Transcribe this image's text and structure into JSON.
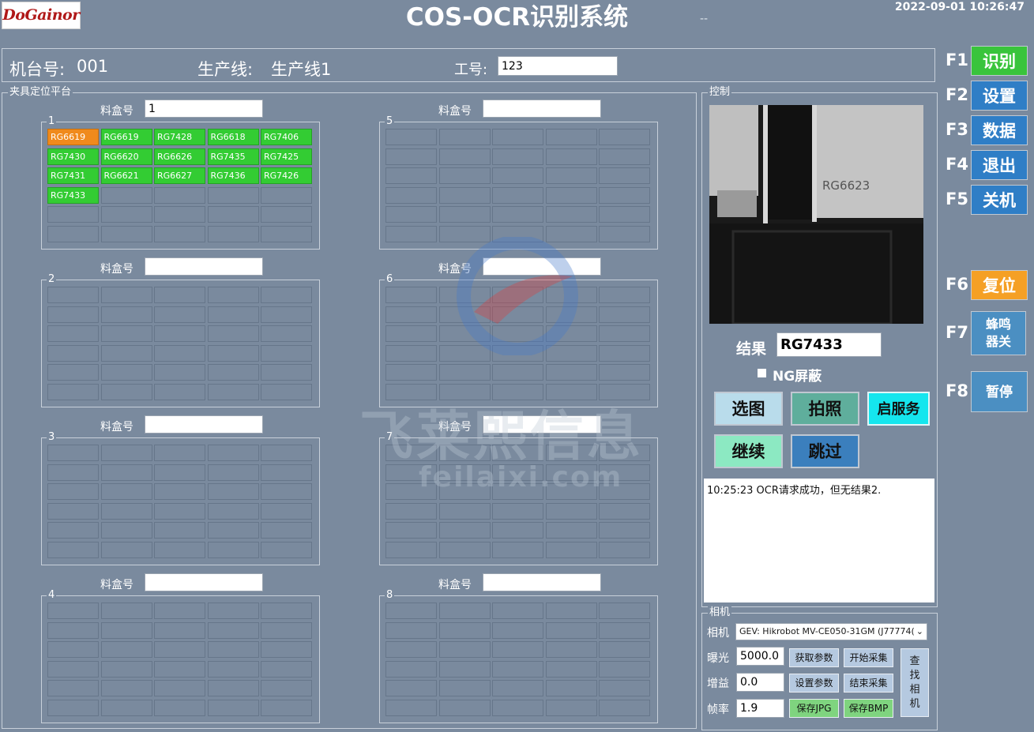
{
  "header": {
    "logo": "DoGainor",
    "title": "COS-OCR识别系统",
    "dash": "--",
    "datetime": "2022-09-01 10:26:47"
  },
  "info": {
    "machine_label": "机台号:",
    "machine_value": "001",
    "line_label": "生产线:",
    "line_value": "生产线1",
    "job_label": "工号:",
    "job_value": "123"
  },
  "fixture": {
    "title": "夹具定位平台",
    "box_label": "料盒号",
    "trays": [
      {
        "num": "1",
        "box": "1",
        "cells": [
          {
            "text": "RG6619",
            "state": "cur"
          },
          {
            "text": "RG6619",
            "state": "ok"
          },
          {
            "text": "RG7428",
            "state": "ok"
          },
          {
            "text": "RG6618",
            "state": "ok"
          },
          {
            "text": "RG7406",
            "state": "ok"
          },
          {
            "text": "RG7430",
            "state": "ok"
          },
          {
            "text": "RG6620",
            "state": "ok"
          },
          {
            "text": "RG6626",
            "state": "ok"
          },
          {
            "text": "RG7435",
            "state": "ok"
          },
          {
            "text": "RG7425",
            "state": "ok"
          },
          {
            "text": "RG7431",
            "state": "ok"
          },
          {
            "text": "RG6621",
            "state": "ok"
          },
          {
            "text": "RG6627",
            "state": "ok"
          },
          {
            "text": "RG7436",
            "state": "ok"
          },
          {
            "text": "RG7426",
            "state": "ok"
          },
          {
            "text": "RG7433",
            "state": "ok"
          }
        ]
      },
      {
        "num": "2",
        "box": "",
        "cells": []
      },
      {
        "num": "3",
        "box": "",
        "cells": []
      },
      {
        "num": "4",
        "box": "",
        "cells": []
      },
      {
        "num": "5",
        "box": "",
        "cells": []
      },
      {
        "num": "6",
        "box": "",
        "cells": []
      },
      {
        "num": "7",
        "box": "",
        "cells": []
      },
      {
        "num": "8",
        "box": "",
        "cells": []
      }
    ]
  },
  "control": {
    "title": "控制",
    "image_text": "RG6623",
    "result_label": "结果",
    "result_value": "RG7433",
    "ng_label": "NG屏蔽",
    "buttons": {
      "select_image": "选图",
      "capture": "拍照",
      "start_service": "启服务",
      "continue": "继续",
      "skip": "跳过"
    },
    "log": "10:25:23 OCR请求成功，但无结果2."
  },
  "camera": {
    "title": "相机",
    "camera_label": "相机",
    "camera_value": "GEV: Hikrobot MV-CE050-31GM (J77774(",
    "exposure_label": "曝光",
    "exposure_value": "5000.0",
    "gain_label": "增益",
    "gain_value": "0.0",
    "fps_label": "帧率",
    "fps_value": "1.9",
    "get_params": "获取参数",
    "set_params": "设置参数",
    "start_capture": "开始采集",
    "end_capture": "结束采集",
    "save_jpg": "保存JPG",
    "save_bmp": "保存BMP",
    "find_camera": "查找相机"
  },
  "fkeys": [
    {
      "key": "F1",
      "label": "识别",
      "color": "#39c43c"
    },
    {
      "key": "F2",
      "label": "设置",
      "color": "#2f7ec6"
    },
    {
      "key": "F3",
      "label": "数据",
      "color": "#2f7ec6"
    },
    {
      "key": "F4",
      "label": "退出",
      "color": "#2f7ec6"
    },
    {
      "key": "F5",
      "label": "关机",
      "color": "#2f7ec6"
    },
    {
      "key": "F6",
      "label": "复位",
      "color": "#f5a025"
    },
    {
      "key": "F7",
      "label": "蜂鸣器关",
      "color": "#4b8fc2"
    },
    {
      "key": "F8",
      "label": "暂停",
      "color": "#4b8fc2"
    }
  ],
  "watermark": {
    "text": "飞莱熙信息",
    "url": "feilaixi.com"
  }
}
